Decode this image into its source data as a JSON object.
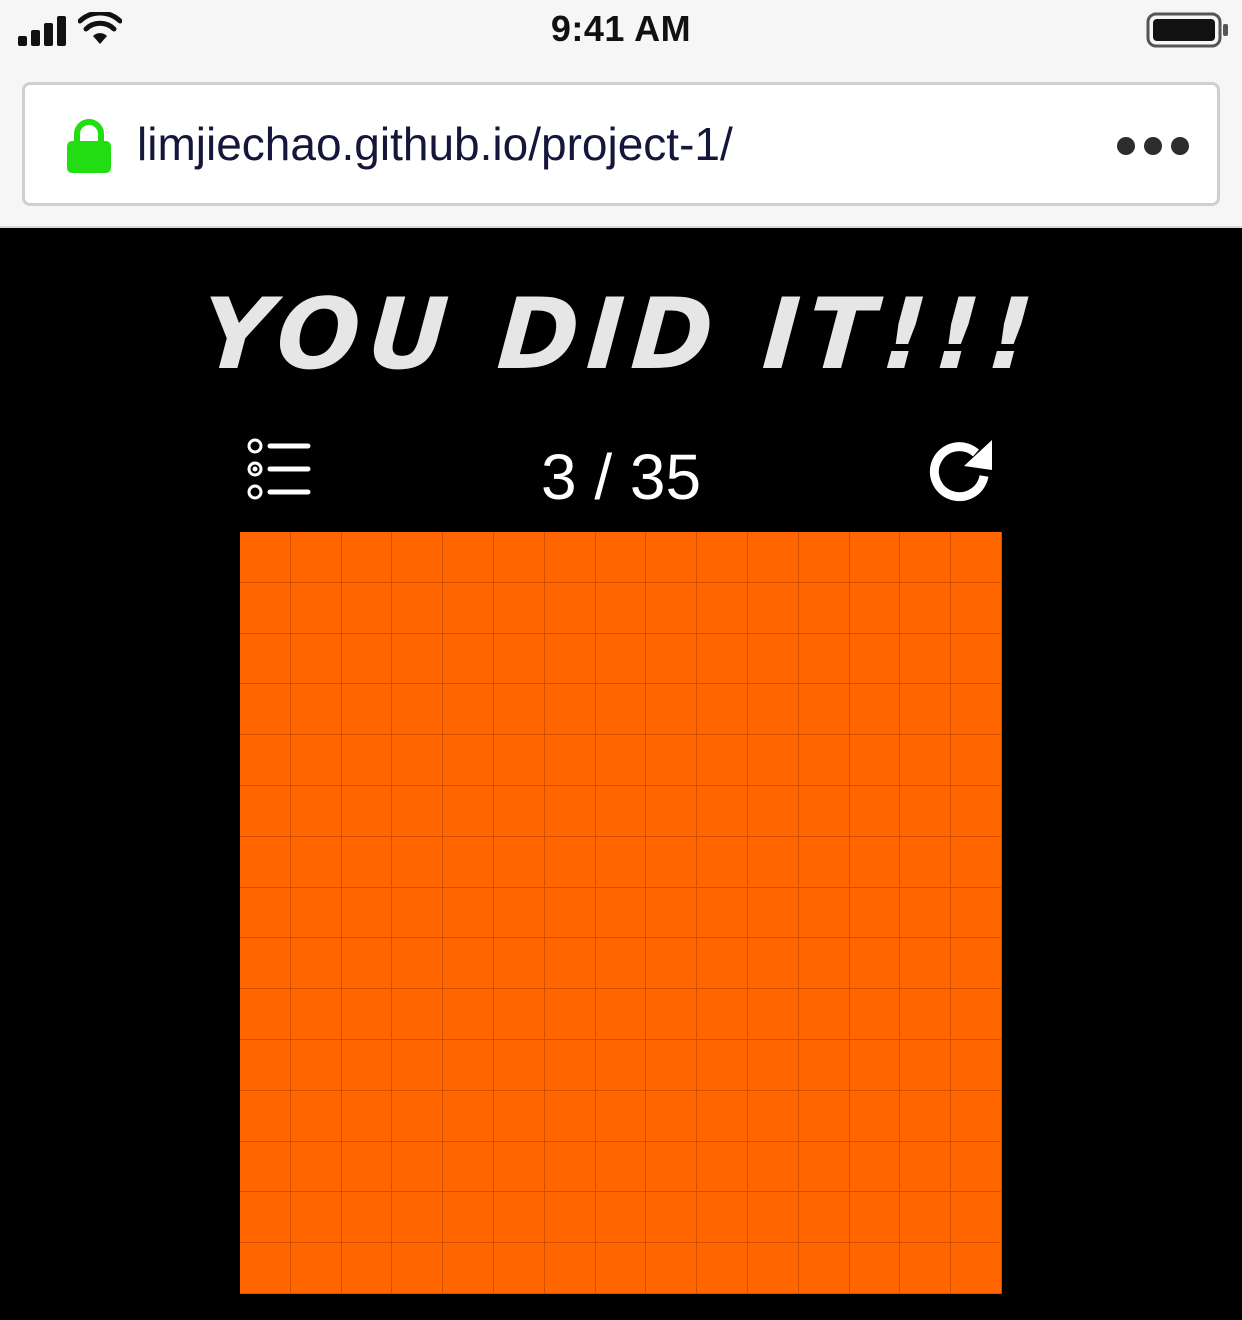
{
  "status_bar": {
    "time": "9:41 AM"
  },
  "browser": {
    "url": "limjiechao.github.io/project-1/",
    "secure": true
  },
  "game": {
    "title": "YOU DID IT!!!",
    "level_current": "3",
    "level_separator": "/",
    "level_total": "35",
    "level_text": "3 / 35",
    "board_rows": 15,
    "board_cols": 15,
    "board_fill": "#ff6600"
  },
  "icons": {
    "menu": "level-list-icon",
    "restart": "restart-icon",
    "lock": "lock-icon",
    "more": "more-options-icon"
  },
  "colors": {
    "background": "#000000",
    "board": "#ff6600",
    "title": "#e6e6e6",
    "lock": "#22dd11"
  }
}
